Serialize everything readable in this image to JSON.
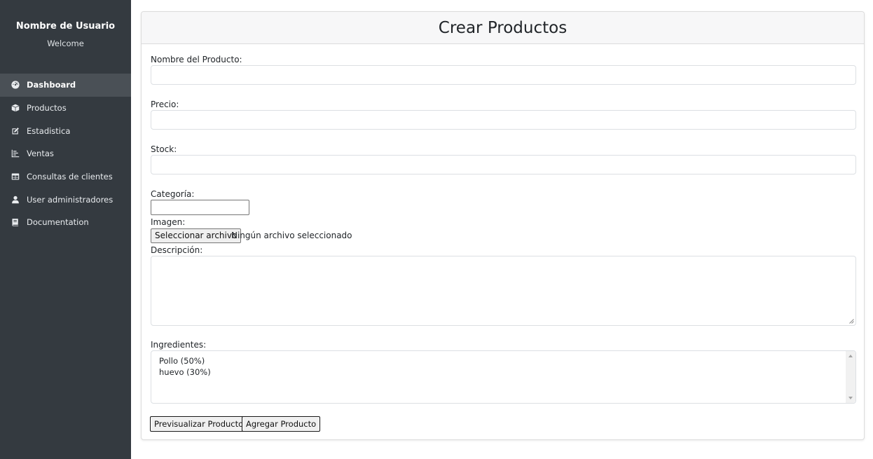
{
  "sidebar": {
    "user_name": "Nombre de Usuario",
    "welcome": "Welcome",
    "items": [
      {
        "label": "Dashboard",
        "icon": "dashboard-icon",
        "active": true
      },
      {
        "label": "Productos",
        "icon": "box-icon"
      },
      {
        "label": "Estadistica",
        "icon": "edit-icon"
      },
      {
        "label": "Ventas",
        "icon": "chart-icon"
      },
      {
        "label": "Consultas de clientes",
        "icon": "table-icon"
      },
      {
        "label": "User administradores",
        "icon": "user-icon"
      },
      {
        "label": "Documentation",
        "icon": "book-icon"
      }
    ]
  },
  "form": {
    "title": "Crear Productos",
    "name_label": "Nombre del Producto:",
    "price_label": "Precio:",
    "stock_label": "Stock:",
    "category_label": "Categoría:",
    "image_label": "Imagen:",
    "file_button": "Seleccionar archivo",
    "file_status": "Ningún archivo seleccionado",
    "description_label": "Descripción:",
    "ingredients_label": "Ingredientes:",
    "ingredients": [
      "Pollo (50%)",
      "huevo (30%)"
    ],
    "preview_button": "Previsualizar Producto",
    "add_button": "Agregar Producto"
  },
  "colors": {
    "sidebar_bg": "#343a40",
    "active_item_bg": "#4a5056",
    "card_header_bg": "#f7f7f8"
  }
}
